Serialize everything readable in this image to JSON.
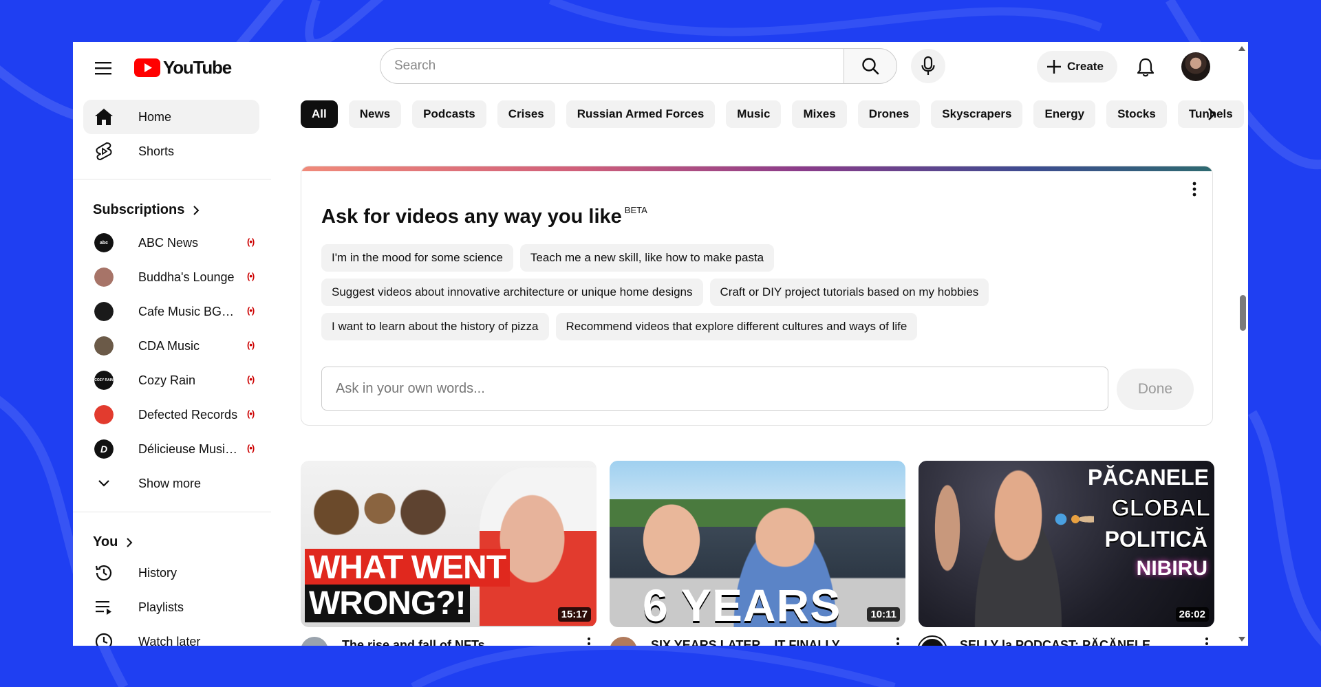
{
  "header": {
    "logo_text": "YouTube",
    "search_placeholder": "Search",
    "create_label": "Create"
  },
  "sidebar": {
    "main": [
      {
        "label": "Home",
        "icon": "home-icon"
      },
      {
        "label": "Shorts",
        "icon": "shorts-icon"
      }
    ],
    "subscriptions_heading": "Subscriptions",
    "subscriptions": [
      {
        "label": "ABC News",
        "avatar_text": "abc",
        "color": "#111111"
      },
      {
        "label": "Buddha's Lounge",
        "avatar_text": "",
        "color": "#a77468"
      },
      {
        "label": "Cafe Music BGM...",
        "avatar_text": "",
        "color": "#1a1a1a"
      },
      {
        "label": "CDA Music",
        "avatar_text": "",
        "color": "#6b5a48"
      },
      {
        "label": "Cozy Rain",
        "avatar_text": "COZY RAIN",
        "color": "#111111"
      },
      {
        "label": "Defected Records",
        "avatar_text": "",
        "color": "#e23b2e"
      },
      {
        "label": "Délicieuse Musiq...",
        "avatar_text": "D",
        "color": "#111111"
      }
    ],
    "show_more": "Show more",
    "you_heading": "You",
    "you_items": [
      {
        "label": "History",
        "icon": "history-icon"
      },
      {
        "label": "Playlists",
        "icon": "playlists-icon"
      },
      {
        "label": "Watch later",
        "icon": "watch-later-icon"
      }
    ]
  },
  "chips": [
    "All",
    "News",
    "Podcasts",
    "Crises",
    "Russian Armed Forces",
    "Music",
    "Mixes",
    "Drones",
    "Skyscrapers",
    "Energy",
    "Stocks",
    "Tunnels"
  ],
  "ask": {
    "title": "Ask for videos any way you like",
    "beta": "BETA",
    "prompts": [
      [
        "I'm in the mood for some science",
        "Teach me a new skill, like how to make pasta"
      ],
      [
        "Suggest videos about innovative architecture or unique home designs",
        "Craft or DIY project tutorials based on my hobbies"
      ],
      [
        "I want to learn about the history of pizza",
        "Recommend videos that explore different cultures and ways of life"
      ]
    ],
    "input_placeholder": "Ask in your own words...",
    "done_label": "Done"
  },
  "videos": [
    {
      "title": "The rise and fall of NFTs",
      "duration": "15:17",
      "thumb_text": [
        "WHAT WENT",
        "WRONG?!"
      ]
    },
    {
      "title": "SIX YEARS LATER... IT FINALLY...",
      "duration": "10:11",
      "thumb_text": [
        "6 YEARS"
      ]
    },
    {
      "title": "SELLY la PODCAST: PĂCĂNELE...",
      "duration": "26:02",
      "thumb_text": [
        "PĂCANELE",
        "GLOBAL",
        "POLITICĂ",
        "NIBIRU"
      ]
    }
  ]
}
